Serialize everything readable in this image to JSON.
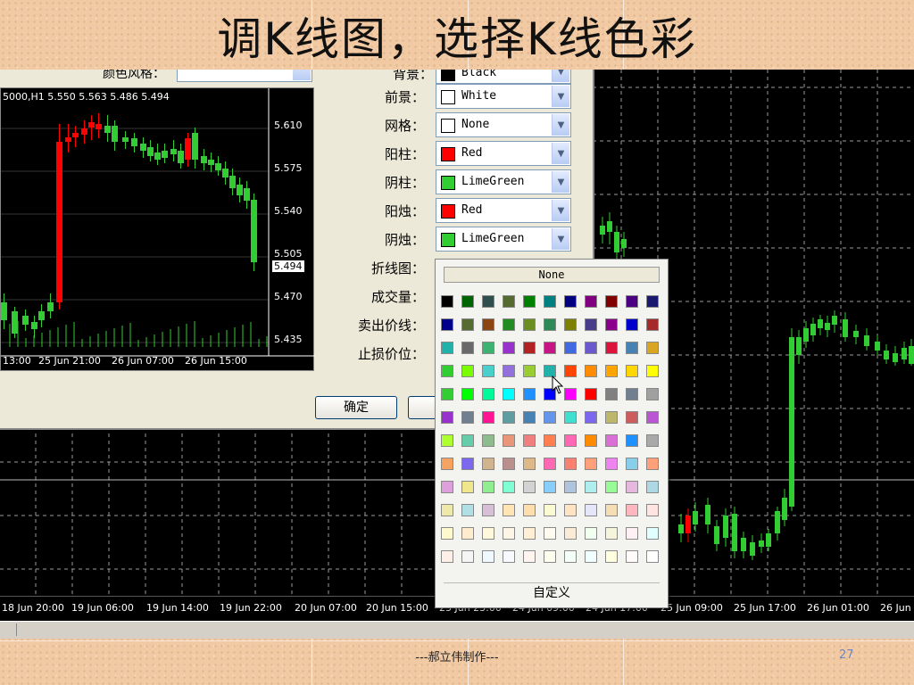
{
  "slide": {
    "title": "调K线图，选择K线色彩",
    "footer": "---郝立伟制作---",
    "page_number": "27"
  },
  "dialog": {
    "cut_labels": [
      "颜色风格：",
      "背景：",
      "Black"
    ],
    "mini_chart": {
      "header": "5000,H1  5.550 5.563 5.486 5.494",
      "price_labels": [
        "5.610",
        "5.575",
        "5.540",
        "5.505",
        "5.494",
        "5.470",
        "5.435"
      ],
      "time_labels": [
        "13:00",
        "25 Jun 21:00",
        "26 Jun 07:00",
        "26 Jun 15:00"
      ]
    },
    "rows": [
      {
        "label": "前景：",
        "value": "White",
        "color": "#ffffff"
      },
      {
        "label": "网格：",
        "value": "None",
        "color": "#ffffff"
      },
      {
        "label": "阳柱：",
        "value": "Red",
        "color": "#ff0000"
      },
      {
        "label": "阴柱：",
        "value": "LimeGreen",
        "color": "#32cd32"
      },
      {
        "label": "阳烛：",
        "value": "Red",
        "color": "#ff0000"
      },
      {
        "label": "阴烛：",
        "value": "LimeGreen",
        "color": "#32cd32"
      },
      {
        "label": "折线图："
      },
      {
        "label": "成交量："
      },
      {
        "label": "卖出价线："
      },
      {
        "label": "止损价位："
      }
    ],
    "ok_label": "确定"
  },
  "palette": {
    "none_label": "None",
    "custom_label": "自定义",
    "colors": [
      [
        "#000000",
        "#006400",
        "#2f4f4f",
        "#556b2f",
        "#008000",
        "#008080",
        "#000080",
        "#800080",
        "#800000",
        "#4b0082",
        "#191970"
      ],
      [
        "#00008b",
        "#556b2f",
        "#8b4513",
        "#228b22",
        "#6b8e23",
        "#2e8b57",
        "#808000",
        "#483d8b",
        "#8b008b",
        "#0000cd",
        "#a52a2a"
      ],
      [
        "#20b2aa",
        "#696969",
        "#3cb371",
        "#9932cc",
        "#b22222",
        "#c71585",
        "#4169e1",
        "#6a5acd",
        "#dc143c",
        "#4682b4",
        "#daa520"
      ],
      [
        "#32cd32",
        "#7cfc00",
        "#48d1cc",
        "#9370db",
        "#9acd32",
        "#20b2aa",
        "#ff4500",
        "#ff8c00",
        "#ffa500",
        "#ffd700",
        "#ffff00"
      ],
      [
        "#32cd32",
        "#00ff00",
        "#00fa9a",
        "#00ffff",
        "#1e90ff",
        "#0000ff",
        "#ff00ff",
        "#ff0000",
        "#808080",
        "#708090",
        "#a0a0a0"
      ],
      [
        "#9932cc",
        "#708090",
        "#ff1493",
        "#5f9ea0",
        "#4682b4",
        "#6495ed",
        "#40e0d0",
        "#7b68ee",
        "#bdb76b",
        "#cd5c5c",
        "#ba55d3"
      ],
      [
        "#adff2f",
        "#66cdaa",
        "#8fbc8f",
        "#e9967a",
        "#f08080",
        "#ff7f50",
        "#ff69b4",
        "#ff8c00",
        "#da70d6",
        "#1e90ff",
        "#a9a9a9"
      ],
      [
        "#f4a460",
        "#7b68ee",
        "#d2b48c",
        "#bc8f8f",
        "#deb887",
        "#ff69b4",
        "#fa8072",
        "#ffa07a",
        "#ee82ee",
        "#87ceeb",
        "#ffa07a"
      ],
      [
        "#dda0dd",
        "#f0e68c",
        "#90ee90",
        "#7fffd4",
        "#d3d3d3",
        "#87cefa",
        "#b0c4de",
        "#afeeee",
        "#98fb98",
        "#e6b8e0",
        "#add8e6"
      ],
      [
        "#eee8aa",
        "#b0e0e6",
        "#d8bfd8",
        "#ffe4b5",
        "#ffdead",
        "#fafad2",
        "#ffe4c4",
        "#e6e6fa",
        "#f5deb3",
        "#ffb6c1",
        "#ffe4e1"
      ],
      [
        "#fffacd",
        "#ffebcd",
        "#fff8dc",
        "#fdf5e6",
        "#ffefd5",
        "#fffaf0",
        "#faebd7",
        "#f0fff0",
        "#f5f5dc",
        "#fff0f5",
        "#e0ffff"
      ],
      [
        "#ffefe8",
        "#f5f5f5",
        "#f0f8ff",
        "#f8f8ff",
        "#fff5ee",
        "#fffff0",
        "#f5fffa",
        "#f0ffff",
        "#ffffe0",
        "#fffafa",
        "#ffffff"
      ]
    ]
  },
  "main_chart": {
    "time_labels": [
      "18 Jun 20:00",
      "19 Jun 06:00",
      "19 Jun 14:00",
      "19 Jun 22:00",
      "20 Jun 07:00",
      "20 Jun 15:00",
      "23 Jun 23:00",
      "24 Jun 09:00",
      "24 Jun 17:00",
      "25 Jun 09:00",
      "25 Jun 17:00",
      "26 Jun 01:00",
      "26 Jun"
    ]
  }
}
